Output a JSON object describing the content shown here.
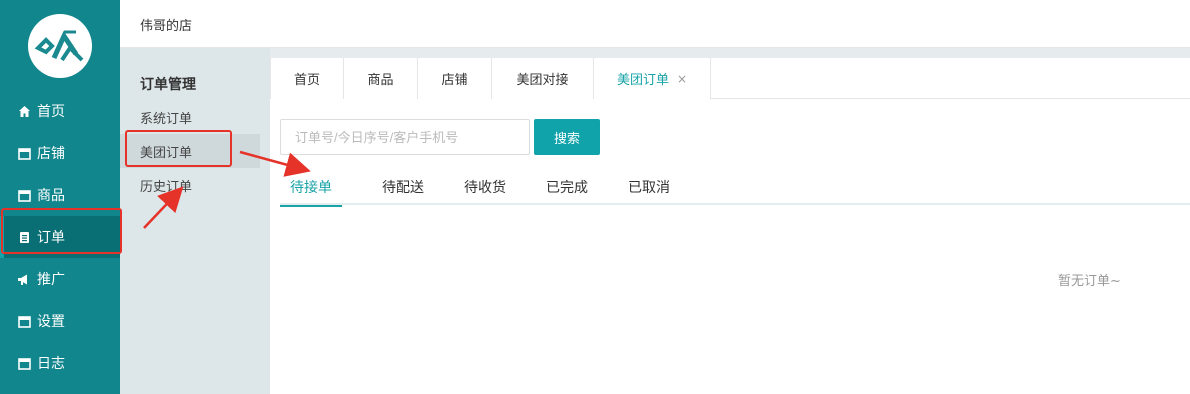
{
  "sidebar": {
    "logo_icon": "brand-logo-icon",
    "items": [
      {
        "label": "首页",
        "icon": "home-icon"
      },
      {
        "label": "店铺",
        "icon": "store-icon"
      },
      {
        "label": "商品",
        "icon": "goods-icon"
      },
      {
        "label": "订单",
        "icon": "order-icon",
        "active": true
      },
      {
        "label": "推广",
        "icon": "megaphone-icon"
      },
      {
        "label": "设置",
        "icon": "settings-icon"
      },
      {
        "label": "日志",
        "icon": "log-icon"
      }
    ]
  },
  "topbar": {
    "shop_name": "伟哥的店"
  },
  "subnav": {
    "group_title": "订单管理",
    "items": [
      {
        "label": "系统订单"
      },
      {
        "label": "美团订单",
        "active": true
      },
      {
        "label": "历史订单"
      }
    ]
  },
  "tabs": [
    {
      "label": "首页"
    },
    {
      "label": "商品"
    },
    {
      "label": "店铺"
    },
    {
      "label": "美团对接"
    },
    {
      "label": "美团订单",
      "active": true,
      "close": "×"
    }
  ],
  "search": {
    "placeholder": "订单号/今日序号/客户手机号",
    "value": "",
    "button_label": "搜索"
  },
  "status_tabs": [
    {
      "label": "待接单",
      "active": true
    },
    {
      "label": "待配送"
    },
    {
      "label": "待收货"
    },
    {
      "label": "已完成"
    },
    {
      "label": "已取消"
    }
  ],
  "empty_text": "暂无订单~",
  "colors": {
    "sidebar_bg": "#11868c",
    "accent": "#19a3a7",
    "annotation": "#e5332a"
  }
}
